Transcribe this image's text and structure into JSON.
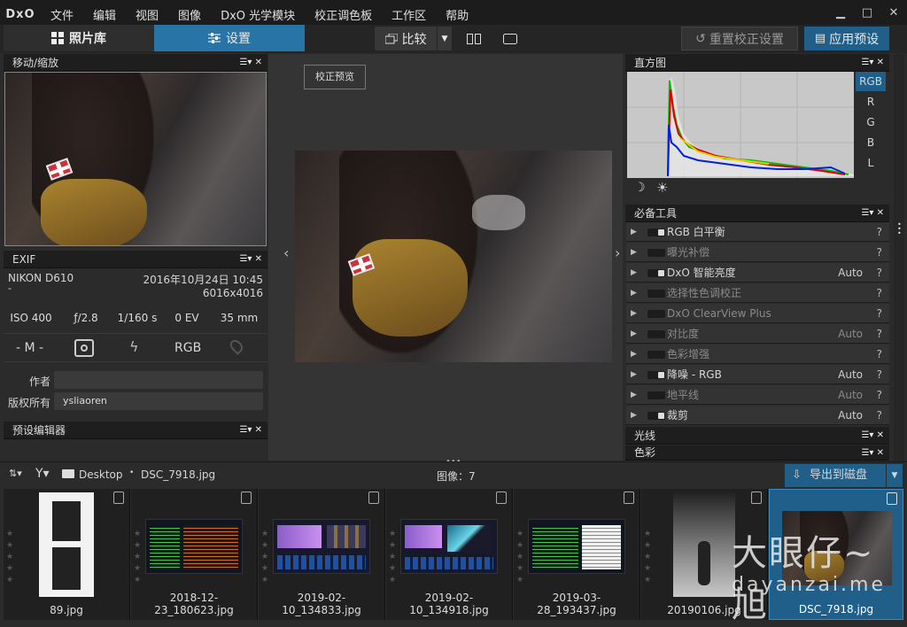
{
  "app": {
    "logo": "DxO"
  },
  "menu": [
    "文件",
    "编辑",
    "视图",
    "图像",
    "DxO 光学模块",
    "校正调色板",
    "工作区",
    "帮助"
  ],
  "window_controls": [
    "▁",
    "□",
    "✕"
  ],
  "toolbar": {
    "library_tab": "照片库",
    "settings_tab": "设置",
    "compare": "比较",
    "reset": "重置校正设置",
    "apply_preset": "应用预设"
  },
  "panels": {
    "navigator": "移动/缩放",
    "exif": "EXIF",
    "preset_editor": "预设编辑器",
    "histogram": "直方图",
    "essential_tools": "必备工具",
    "light": "光线",
    "color": "色彩",
    "panel_ctl": "☰▾ ✕"
  },
  "exif": {
    "camera": "NIKON D610",
    "lens": "-",
    "date": "2016年10月24日 10:45",
    "dimensions": "6016x4016",
    "iso": "ISO 400",
    "aperture": "ƒ/2.8",
    "shutter": "1/160 s",
    "ev": "0 EV",
    "focal": "35 mm",
    "mode": "- M -",
    "color_space": "RGB",
    "author_label": "作者",
    "author_value": "",
    "copyright_label": "版权所有",
    "copyright_value": "ysliaoren"
  },
  "viewer": {
    "preview_button": "校正预览",
    "left_arrow": "‹",
    "right_arrow": "›"
  },
  "histogram": {
    "channels": [
      "RGB",
      "R",
      "G",
      "B",
      "L"
    ],
    "selected": "RGB"
  },
  "tools": [
    {
      "label": "RGB 白平衡",
      "value": "",
      "active": true
    },
    {
      "label": "曝光补偿",
      "value": "",
      "active": false
    },
    {
      "label": "DxO 智能亮度",
      "value": "Auto",
      "active": true
    },
    {
      "label": "选择性色调校正",
      "value": "",
      "active": false
    },
    {
      "label": "DxO ClearView Plus",
      "value": "",
      "active": false
    },
    {
      "label": "对比度",
      "value": "Auto",
      "active": false
    },
    {
      "label": "色彩增强",
      "value": "",
      "active": false
    },
    {
      "label": "降噪 - RGB",
      "value": "Auto",
      "active": true
    },
    {
      "label": "地平线",
      "value": "Auto",
      "active": false
    },
    {
      "label": "裁剪",
      "value": "Auto",
      "active": true
    }
  ],
  "filmstrip": {
    "path_folder": "Desktop",
    "path_file": "DSC_7918.jpg",
    "count": "图像：7",
    "export": "导出到磁盘",
    "items": [
      "89.jpg",
      "2018-12-23_180623.jpg",
      "2019-02-10_134833.jpg",
      "2019-02-10_134918.jpg",
      "2019-03-28_193437.jpg",
      "20190106.jpg",
      "DSC_7918.jpg"
    ],
    "selected_index": 6
  },
  "watermark": {
    "text1": "大眼仔~旭",
    "text2": "dayanzai.me"
  },
  "colors": {
    "accent": "#1f5f8a",
    "active_tab": "#2874a6",
    "bg": "#2b2b2b"
  }
}
